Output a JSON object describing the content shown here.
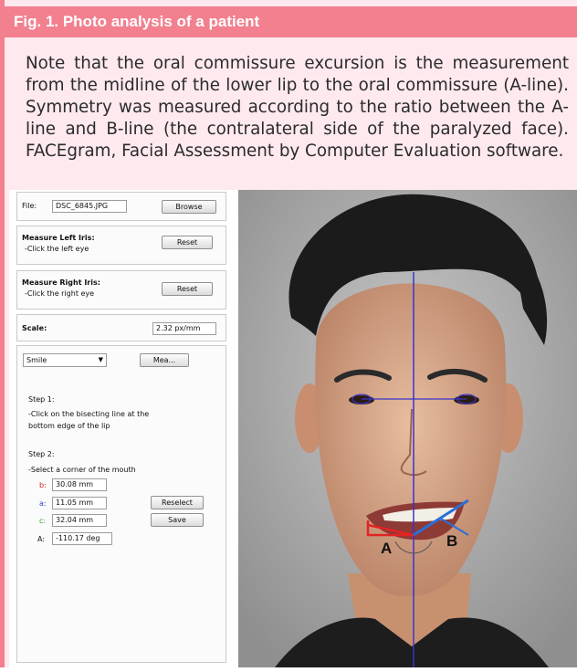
{
  "figure": {
    "title": "Fig. 1. Photo analysis of a patient",
    "caption": "Note that the oral commissure excursion is the measurement from the midline of the lower lip to the oral commissure (A-line). Symmetry was measured according to the ratio between the A-line and B-line (the contralateral side of the paralyzed face). FACEgram, Facial Assessment by Computer Evaluation software."
  },
  "software": {
    "file": {
      "label": "File:",
      "value": "DSC_6845.JPG",
      "button": "Browse"
    },
    "left_iris": {
      "title": "Measure Left Iris:",
      "hint": "-Click the left eye",
      "button": "Reset"
    },
    "right_iris": {
      "title": "Measure Right Iris:",
      "hint": "-Click the right eye",
      "button": "Reset"
    },
    "scale": {
      "label": "Scale:",
      "value": "2.32 px/mm"
    },
    "mode": {
      "selected": "Smile",
      "button": "Mea..."
    },
    "step1": {
      "title": "Step 1:",
      "line1": "-Click on the bisecting line at the",
      "line2": "bottom edge of the lip"
    },
    "step2": {
      "title": "Step 2:",
      "line1": "-Select a corner of the mouth"
    },
    "measures": {
      "b": {
        "label": "b:",
        "value": "30.08 mm",
        "color": "#d02020"
      },
      "a": {
        "label": "a:",
        "value": "11.05 mm",
        "color": "#2848c8"
      },
      "c": {
        "label": "c:",
        "value": "32.04 mm",
        "color": "#28a028"
      },
      "angle": {
        "label": "A:",
        "value": "-110.17 deg"
      }
    },
    "reselect_button": "Reselect",
    "save_button": "Save"
  },
  "photo": {
    "label_a": "A",
    "label_b": "B",
    "line_colors": {
      "midline": "#3a35c8",
      "a_line": "#e02424",
      "b_line": "#2a6fd8"
    }
  }
}
